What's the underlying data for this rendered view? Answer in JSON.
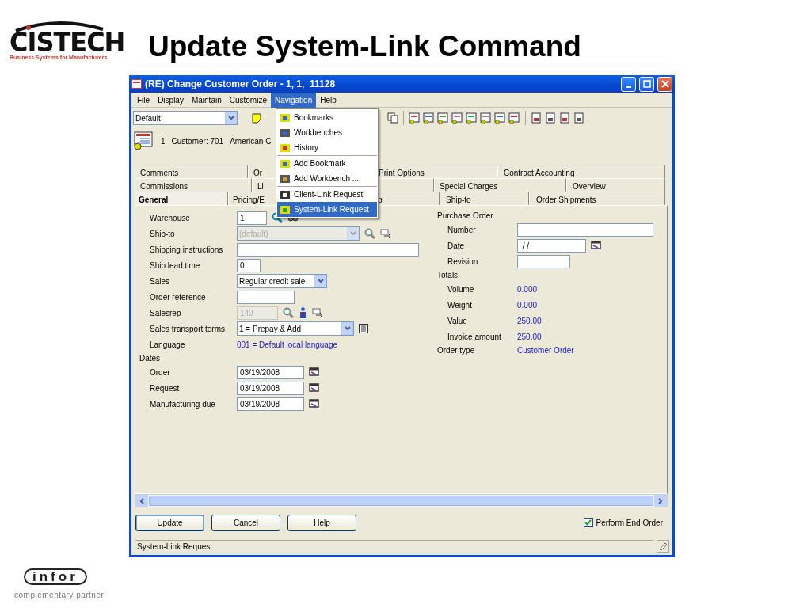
{
  "slide": {
    "title": "Update System-Link Command",
    "logo": {
      "name": "CISTECH",
      "tagline": "Business Systems for Manufacturers"
    },
    "footer_logo": {
      "name": "infor",
      "tagline": "complementary partner"
    }
  },
  "window": {
    "title": "(RE) Change Customer Order - 1, 1,  11128",
    "menu": [
      {
        "label": "File",
        "selected": false
      },
      {
        "label": "Display",
        "selected": false
      },
      {
        "label": "Maintain",
        "selected": false
      },
      {
        "label": "Customize",
        "selected": false
      },
      {
        "label": "Navigation",
        "selected": true
      },
      {
        "label": "Help",
        "selected": false
      }
    ],
    "open_menu": {
      "groups": [
        [
          {
            "label": "Bookmarks",
            "selected": false
          },
          {
            "label": "Workbenches",
            "selected": false
          },
          {
            "label": "History",
            "selected": false
          }
        ],
        [
          {
            "label": "Add Bookmark",
            "selected": false
          },
          {
            "label": "Add Workbench ...",
            "selected": false
          }
        ],
        [
          {
            "label": "Client-Link Request",
            "selected": false
          },
          {
            "label": "System-Link Request",
            "selected": true
          }
        ]
      ]
    },
    "toolbar": {
      "view": "Default"
    },
    "customer_line": {
      "number": "1",
      "customer": "Customer: 701",
      "name": "American C"
    },
    "tab_rows": [
      [
        {
          "label": "Comments",
          "selected": false
        },
        {
          "label": "Or",
          "selected": false
        },
        {
          "label": "Print Options",
          "selected": false
        },
        {
          "label": "Contract Accounting",
          "selected": false
        }
      ],
      [
        {
          "label": "Commissions",
          "selected": false
        },
        {
          "label": "Li",
          "selected": false
        },
        {
          "label": "Special Charges",
          "selected": false
        },
        {
          "label": "Overview",
          "selected": false
        }
      ],
      [
        {
          "label": "General",
          "selected": true
        },
        {
          "label": "Pricing/E",
          "selected": false
        },
        {
          "label": "p",
          "selected": false
        },
        {
          "label": "Ship-to",
          "selected": false
        },
        {
          "label": "Order Shipments",
          "selected": false
        }
      ]
    ],
    "columns": [
      [
        {
          "children": [
            {
              "label": "Warehouse",
              "kind": "text",
              "value": "1",
              "disabled": false
            },
            {
              "label": "Ship-to",
              "kind": "combo",
              "value": "(default)",
              "disabled": true
            },
            {
              "label": "Shipping instructions",
              "kind": "text",
              "disabled": false
            },
            {
              "label": "Ship lead time",
              "kind": "text",
              "value": "0",
              "disabled": false
            },
            {
              "label": "Sales",
              "kind": "combo",
              "value": "Regular credit sale",
              "disabled": false
            },
            {
              "label": "Order reference",
              "kind": "text",
              "disabled": false
            },
            {
              "label": "Salesrep",
              "kind": "text",
              "value": "140",
              "disabled": true
            },
            {
              "label": "Sales transport terms",
              "kind": "combo",
              "value": "1 = Prepay & Add",
              "disabled": false
            },
            {
              "label": "Language",
              "kind": "static",
              "value": "001 = Default local language"
            }
          ]
        },
        {
          "label": "Dates",
          "children": [
            {
              "label": "Order",
              "kind": "text",
              "value": "03/19/2008",
              "disabled": false
            },
            {
              "label": "Request",
              "kind": "text",
              "value": "03/19/2008",
              "disabled": false
            },
            {
              "label": "Manufacturing due",
              "kind": "text",
              "value": "03/19/2008",
              "disabled": false
            }
          ]
        }
      ],
      [
        {
          "label": "Purchase Order",
          "children": [
            {
              "label": "Number",
              "kind": "text",
              "disabled": false
            },
            {
              "label": "Date",
              "kind": "text",
              "value": " / /",
              "disabled": false
            },
            {
              "label": "Revision",
              "kind": "text",
              "disabled": false
            }
          ]
        },
        {
          "label": "Totals",
          "children": [
            {
              "label": "Volume",
              "kind": "static",
              "value": "0.000"
            },
            {
              "label": "Weight",
              "kind": "static",
              "value": "0.000"
            },
            {
              "label": "Value",
              "kind": "static",
              "value": "250.00"
            },
            {
              "label": "Invoice amount",
              "kind": "static",
              "value": "250.00"
            }
          ]
        },
        {
          "label": "Order type",
          "kind": "static",
          "value": "Customer Order"
        }
      ]
    ],
    "buttons": [
      "Update",
      "Cancel",
      "Help"
    ],
    "checkbox": {
      "label": "Perform End Order",
      "checked": true
    },
    "status_bar": "System-Link Request"
  }
}
